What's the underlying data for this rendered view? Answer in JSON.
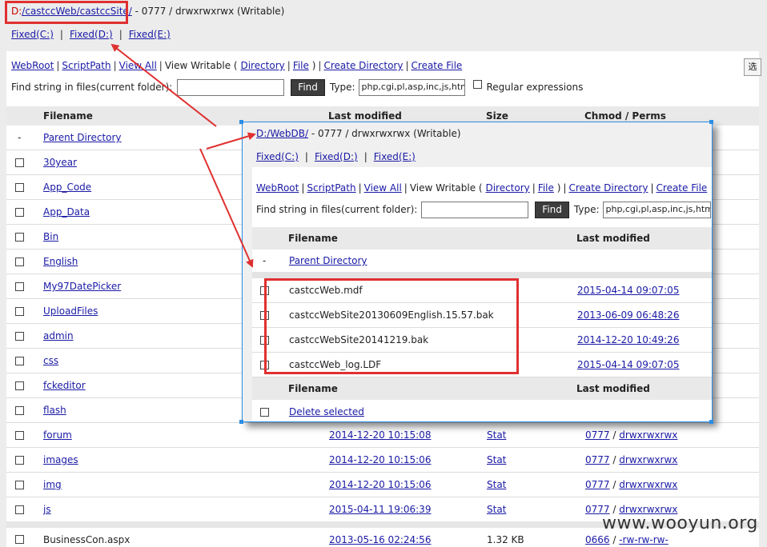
{
  "main": {
    "path": {
      "drive": "D:",
      "seg1": "/castccWeb/",
      "seg2": "castccSite/",
      "suffix": " - 0777 / drwxrwxrwx (Writable)"
    },
    "drives": [
      "Fixed(C:)",
      "Fixed(D:)",
      "Fixed(E:)"
    ],
    "drive_sep": "|",
    "nav": {
      "webroot": "WebRoot",
      "scriptpath": "ScriptPath",
      "viewall": "View All",
      "viewwritable_prefix": "View Writable (",
      "directory": "Directory",
      "file": "File",
      "close_paren": ")",
      "create_directory": "Create Directory",
      "create_file": "Create File"
    },
    "find": {
      "label": "Find string in files(current folder):",
      "button": "Find",
      "type_label": "Type:",
      "type_value": "php,cgi,pl,asp,inc,js,htm",
      "regex_label": "Regular expressions"
    },
    "columns": {
      "filename": "Filename",
      "modified": "Last modified",
      "size": "Size",
      "perms": "Chmod / Perms"
    },
    "parent": {
      "dash": "-",
      "label": "Parent Directory"
    },
    "rows": [
      {
        "name": "30year"
      },
      {
        "name": "App_Code"
      },
      {
        "name": "App_Data"
      },
      {
        "name": "Bin"
      },
      {
        "name": "English"
      },
      {
        "name": "My97DatePicker"
      },
      {
        "name": "UploadFiles"
      },
      {
        "name": "admin"
      },
      {
        "name": "css"
      },
      {
        "name": "fckeditor"
      },
      {
        "name": "flash"
      },
      {
        "name": "forum",
        "modified": "2014-12-20 10:15:08",
        "size": "Stat",
        "perm": "0777",
        "mode": "drwxrwxrwx"
      },
      {
        "name": "images",
        "modified": "2014-12-20 10:15:06",
        "size": "Stat",
        "perm": "0777",
        "mode": "drwxrwxrwx"
      },
      {
        "name": "img",
        "modified": "2014-12-20 10:15:06",
        "size": "Stat",
        "perm": "0777",
        "mode": "drwxrwxrwx"
      },
      {
        "name": "js",
        "modified": "2015-04-11 19:06:39",
        "size": "Stat",
        "perm": "0777",
        "mode": "drwxrwxrwx"
      }
    ],
    "file_row": {
      "name": "BusinessCon.aspx",
      "modified": "2013-05-16 02:24:56",
      "size": "1.32 KB",
      "perm": "0666",
      "mode": "-rw-rw-rw-"
    },
    "edge_button": "选"
  },
  "overlay": {
    "path": {
      "link": "D:/WebDB/",
      "suffix": " - 0777 / drwxrwxrwx (Writable)"
    },
    "columns": {
      "filename": "Filename",
      "modified": "Last modified"
    },
    "files": [
      {
        "name": "castccWeb.mdf",
        "modified": "2015-04-14 09:07:05"
      },
      {
        "name": "castccWebSite20130609English.15.57.bak",
        "modified": "2013-06-09 06:48:26"
      },
      {
        "name": "castccWebSite20141219.bak",
        "modified": "2014-12-20 10:49:26"
      },
      {
        "name": "castccWeb_log.LDF",
        "modified": "2015-04-14 09:07:05"
      }
    ],
    "delete_selected": "Delete selected"
  },
  "watermark": "www.wooyun.org",
  "colors": {
    "annotation_red": "#e03030",
    "link_blue": "#1a1aa6",
    "selection_blue": "#2b8ee6"
  }
}
